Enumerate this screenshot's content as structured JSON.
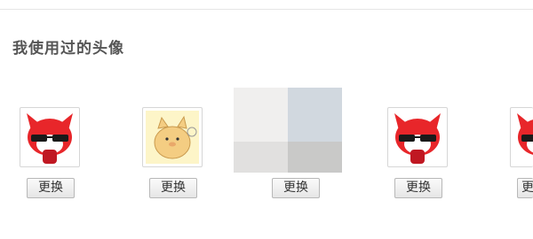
{
  "section": {
    "title": "我使用过的头像"
  },
  "avatars": [
    {
      "icon": "fox-with-sunglasses-icon",
      "button_label": "更换"
    },
    {
      "icon": "cat-pig-cartoon-icon",
      "button_label": "更换"
    },
    {
      "icon": "mosaic-placeholder",
      "button_label": "更换"
    },
    {
      "icon": "fox-with-sunglasses-icon",
      "button_label": "更换"
    },
    {
      "icon": "fox-with-sunglasses-icon",
      "button_label": "更"
    }
  ],
  "colors": {
    "title": "#555555",
    "fox_red": "#e8262a",
    "cat_background": "#fdf5c8",
    "cat_body": "#f4cd82",
    "button_border": "#b8b8b8",
    "divider": "#e5e5e5"
  }
}
